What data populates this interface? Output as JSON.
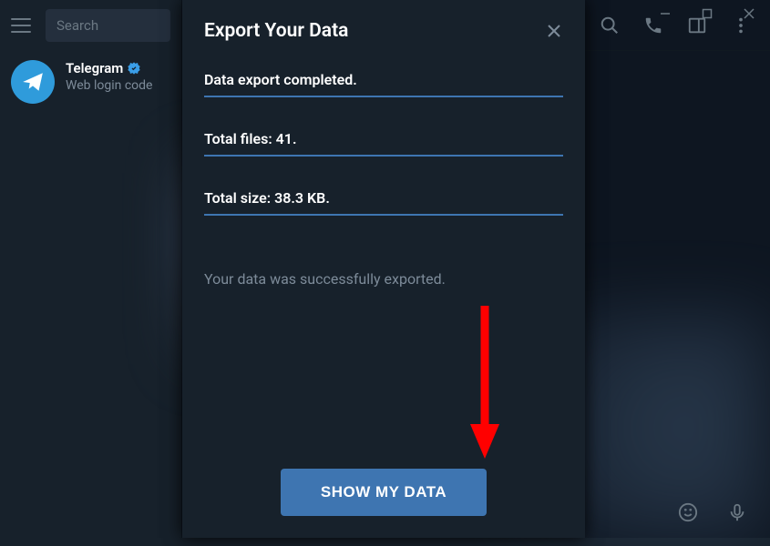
{
  "window_controls": {
    "minimize": "−",
    "maximize": "□",
    "close": "×"
  },
  "sidebar": {
    "search_placeholder": "Search",
    "chat": {
      "title": "Telegram",
      "preview": "Web login code"
    }
  },
  "modal": {
    "title": "Export Your Data",
    "status_completed": "Data export completed.",
    "total_files": "Total files: 41.",
    "total_size": "Total size: 38.3 KB.",
    "success_message": "Your data was successfully exported.",
    "show_button": "SHOW MY DATA"
  },
  "colors": {
    "accent": "#3e75b1",
    "bg_dark": "#17212b",
    "bg_darker": "#0e1621"
  }
}
